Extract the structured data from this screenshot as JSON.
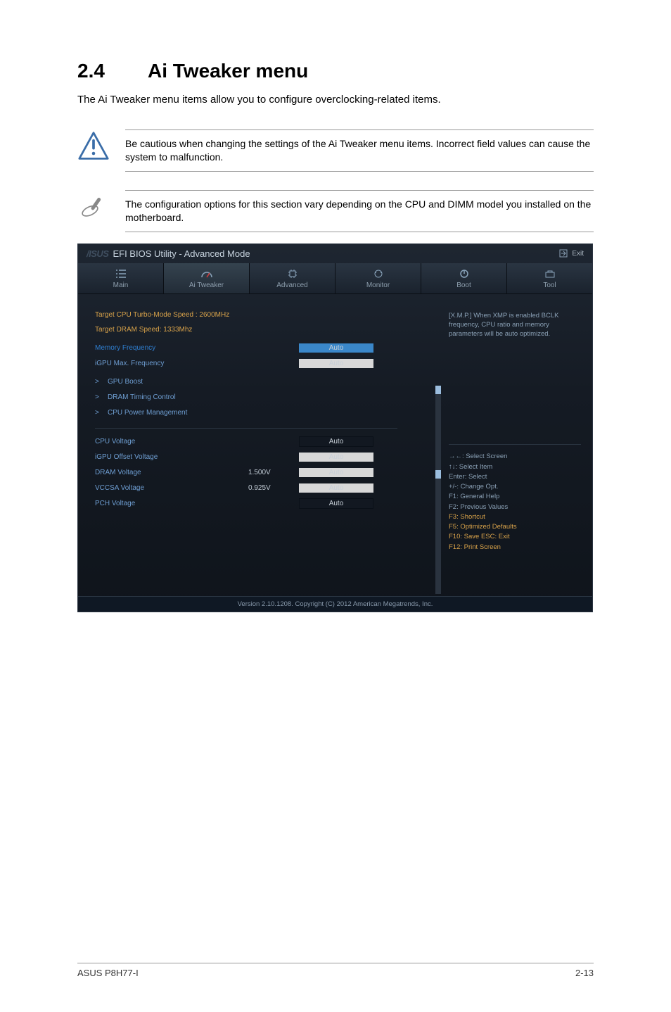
{
  "heading": {
    "number": "2.4",
    "title": "Ai Tweaker menu"
  },
  "intro": "The Ai Tweaker menu items allow you to configure overclocking-related items.",
  "callouts": {
    "caution": "Be cautious when changing the settings of the Ai Tweaker menu items. Incorrect field values can cause the system to malfunction.",
    "note": "The configuration options for this section vary depending on the CPU and DIMM model you installed on the motherboard."
  },
  "bios": {
    "brand": "/ISUS",
    "title": "EFI BIOS Utility - Advanced Mode",
    "exit": "Exit",
    "tabs": {
      "main": "Main",
      "ai_tweaker": "Ai Tweaker",
      "advanced": "Advanced",
      "monitor": "Monitor",
      "boot": "Boot",
      "tool": "Tool"
    },
    "targets": {
      "cpu": "Target CPU Turbo-Mode Speed : 2600MHz",
      "dram": "Target DRAM Speed: 1333Mhz"
    },
    "rows": {
      "memory_frequency": {
        "label": "Memory Frequency",
        "value": "Auto"
      },
      "igpu_max_frequency": {
        "label": "iGPU Max. Frequency",
        "value": "Auto"
      },
      "gpu_boost": {
        "label": "GPU Boost"
      },
      "dram_timing_control": {
        "label": "DRAM Timing Control"
      },
      "cpu_power_management": {
        "label": "CPU Power Management"
      },
      "cpu_voltage": {
        "label": "CPU Voltage",
        "value": "Auto"
      },
      "igpu_offset_voltage": {
        "label": "iGPU Offset Voltage",
        "value": "Auto"
      },
      "dram_voltage": {
        "label": "DRAM Voltage",
        "mid": "1.500V",
        "value": "Auto"
      },
      "vccsa_voltage": {
        "label": "VCCSA Voltage",
        "mid": "0.925V",
        "value": "Auto"
      },
      "pch_voltage": {
        "label": "PCH Voltage",
        "value": "Auto"
      }
    },
    "help": "[X.M.P.] When XMP is enabled BCLK frequency, CPU ratio and memory parameters will be auto optimized.",
    "keys": {
      "l1": "→←: Select Screen",
      "l2": "↑↓: Select Item",
      "l3": "Enter: Select",
      "l4": "+/-: Change Opt.",
      "l5": "F1: General Help",
      "l6": "F2: Previous Values",
      "l7": "F3: Shortcut",
      "l8": "F5: Optimized Defaults",
      "l9": "F10: Save   ESC: Exit",
      "l10": "F12: Print Screen"
    },
    "footer": "Version 2.10.1208.  Copyright (C) 2012 American Megatrends, Inc."
  },
  "footer": {
    "left": "ASUS P8H77-I",
    "right": "2-13"
  }
}
